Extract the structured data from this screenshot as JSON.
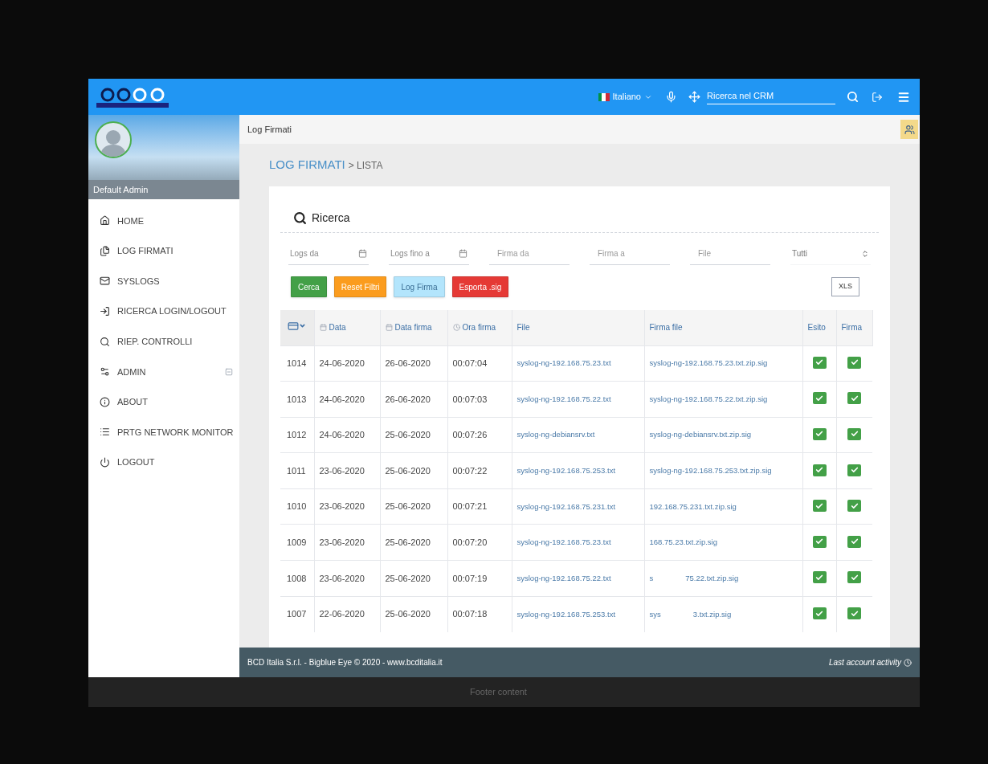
{
  "topbar": {
    "language": "Italiano",
    "search": {
      "placeholder": "Ricerca nel CRM"
    }
  },
  "sidebar": {
    "user": "Default Admin",
    "items": [
      {
        "label": "HOME",
        "expandable": false
      },
      {
        "label": "LOG FIRMATI",
        "expandable": false
      },
      {
        "label": "SYSLOGS",
        "expandable": false
      },
      {
        "label": "RICERCA LOGIN/LOGOUT",
        "expandable": false
      },
      {
        "label": "RIEP. CONTROLLI",
        "expandable": false
      },
      {
        "label": "ADMIN",
        "expandable": true
      },
      {
        "label": "ABOUT",
        "expandable": false
      },
      {
        "label": "PRTG NETWORK MONITOR",
        "expandable": false
      },
      {
        "label": "LOGOUT",
        "expandable": false
      }
    ]
  },
  "breadcrumb": "Log Firmati",
  "page_title": {
    "section": "LOG FIRMATI",
    "sub": "> LISTA"
  },
  "search_label": "Ricerca",
  "filters": [
    {
      "placeholder": "Logs da",
      "kind": "date"
    },
    {
      "placeholder": "Logs fino a",
      "kind": "date"
    },
    {
      "placeholder": "Firma da",
      "kind": "text"
    },
    {
      "placeholder": "Firma a",
      "kind": "text"
    },
    {
      "placeholder": "File",
      "kind": "text"
    },
    {
      "value": "Tutti",
      "kind": "select"
    }
  ],
  "buttons": [
    {
      "label": "Cerca",
      "color": "#43a047"
    },
    {
      "label": "Reset Filtri",
      "color": "#fb9c1e"
    },
    {
      "label": "Log Firma",
      "color": "#b3e5fc"
    },
    {
      "label": "Esporta .sig",
      "color": "#e53935"
    }
  ],
  "export_button": "XLS",
  "table": {
    "columns": [
      {
        "label": "Data"
      },
      {
        "label": "Data firma"
      },
      {
        "label": "Ora firma"
      },
      {
        "label": "File"
      },
      {
        "label": "Firma file"
      },
      {
        "label": "Esito"
      },
      {
        "label": "Firma"
      }
    ],
    "rows": [
      {
        "id": "1014",
        "data": "24-06-2020",
        "data_firma": "26-06-2020",
        "ora_firma": "00:07:04",
        "file": "syslog-ng-192.168.75.23.txt",
        "firma_file": [
          "syslog-ng-192.168.75.23.txt.zip.sig"
        ],
        "esito": true,
        "firma": true
      },
      {
        "id": "1013",
        "data": "24-06-2020",
        "data_firma": "26-06-2020",
        "ora_firma": "00:07:03",
        "file": "syslog-ng-192.168.75.22.txt",
        "firma_file": [
          "syslog-ng-192.168.75.22.txt.zip.sig"
        ],
        "esito": true,
        "firma": true
      },
      {
        "id": "1012",
        "data": "24-06-2020",
        "data_firma": "25-06-2020",
        "ora_firma": "00:07:26",
        "file": "syslog-ng-debiansrv.txt",
        "firma_file": [
          "syslog-ng-debiansrv.txt.zip.sig"
        ],
        "esito": true,
        "firma": true
      },
      {
        "id": "1011",
        "data": "23-06-2020",
        "data_firma": "25-06-2020",
        "ora_firma": "00:07:22",
        "file": "syslog-ng-192.168.75.253.txt",
        "firma_file": [
          "syslog-ng-192.168.75.253.txt.zip.sig"
        ],
        "esito": true,
        "firma": true
      },
      {
        "id": "1010",
        "data": "23-06-2020",
        "data_firma": "25-06-2020",
        "ora_firma": "00:07:21",
        "file": "syslog-ng-192.168.75.231.txt",
        "firma_file": [
          "192.168.75.231.txt.zip.sig"
        ],
        "esito": true,
        "firma": true
      },
      {
        "id": "1009",
        "data": "23-06-2020",
        "data_firma": "25-06-2020",
        "ora_firma": "00:07:20",
        "file": "syslog-ng-192.168.75.23.txt",
        "firma_file": [
          "168.75.23.txt.zip.sig"
        ],
        "esito": true,
        "firma": true
      },
      {
        "id": "1008",
        "data": "23-06-2020",
        "data_firma": "25-06-2020",
        "ora_firma": "00:07:19",
        "file": "syslog-ng-192.168.75.22.txt",
        "firma_file": [
          "s",
          "75.22.txt.zip.sig"
        ],
        "esito": true,
        "firma": true
      },
      {
        "id": "1007",
        "data": "22-06-2020",
        "data_firma": "25-06-2020",
        "ora_firma": "00:07:18",
        "file": "syslog-ng-192.168.75.253.txt",
        "firma_file": [
          "sys",
          "3.txt.zip.sig"
        ],
        "esito": true,
        "firma": true
      }
    ]
  },
  "footer": {
    "left": "BCD Italia S.r.l. - Bigblue Eye © 2020 - www.bcditalia.it",
    "right": "Last account activity"
  },
  "bottom_bar": "Footer content"
}
